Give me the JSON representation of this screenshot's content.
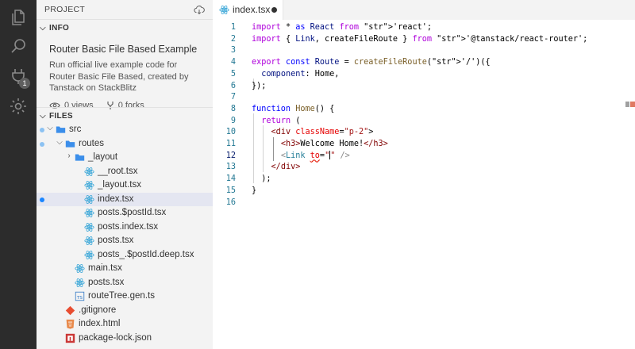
{
  "sidebar": {
    "header": "PROJECT",
    "info_section": {
      "title": "INFO",
      "project_title": "Router Basic File Based Example",
      "description": "Run official live example code for Router Basic File Based, created by Tanstack on StackBlitz",
      "views": "0 views",
      "forks": "0 forks"
    },
    "files_section": {
      "title": "FILES",
      "tree": [
        {
          "label": "src",
          "kind": "folder-open",
          "icon": "folder-icon"
        },
        {
          "label": "routes",
          "kind": "folder-open",
          "icon": "folder-icon"
        },
        {
          "label": "_layout",
          "kind": "folder-closed",
          "icon": "folder-icon"
        },
        {
          "label": "__root.tsx",
          "kind": "file",
          "icon": "react-file-icon"
        },
        {
          "label": "_layout.tsx",
          "kind": "file",
          "icon": "react-file-icon"
        },
        {
          "label": "index.tsx",
          "kind": "file",
          "icon": "react-file-icon"
        },
        {
          "label": "posts.$postId.tsx",
          "kind": "file",
          "icon": "react-file-icon"
        },
        {
          "label": "posts.index.tsx",
          "kind": "file",
          "icon": "react-file-icon"
        },
        {
          "label": "posts.tsx",
          "kind": "file",
          "icon": "react-file-icon"
        },
        {
          "label": "posts_.$postId.deep.tsx",
          "kind": "file",
          "icon": "react-file-icon"
        },
        {
          "label": "main.tsx",
          "kind": "file",
          "icon": "react-file-icon"
        },
        {
          "label": "posts.tsx",
          "kind": "file",
          "icon": "react-file-icon"
        },
        {
          "label": "routeTree.gen.ts",
          "kind": "file",
          "icon": "typescript-file-icon"
        },
        {
          "label": ".gitignore",
          "kind": "file",
          "icon": "git-file-icon"
        },
        {
          "label": "index.html",
          "kind": "file",
          "icon": "html-file-icon"
        },
        {
          "label": "package-lock.json",
          "kind": "file",
          "icon": "npm-file-icon"
        }
      ]
    }
  },
  "activity_bar": {
    "items": [
      "files-icon",
      "search-icon",
      "plug-icon",
      "gear-icon"
    ],
    "badge_count": "1"
  },
  "editor": {
    "tab_label": "index.tsx",
    "line_numbers": [
      "1",
      "2",
      "3",
      "4",
      "5",
      "6",
      "7",
      "8",
      "9",
      "10",
      "11",
      "12",
      "13",
      "14",
      "15",
      "16"
    ],
    "active_line": "12",
    "lines": [
      "import * as React from 'react';",
      "import { Link, createFileRoute } from '@tanstack/react-router';",
      "",
      "export const Route = createFileRoute('/')({",
      "  component: Home,",
      "});",
      "",
      "function Home() {",
      "  return (",
      "    <div className=\"p-2\">",
      "      <h3>Welcome Home!</h3>",
      "      <Link to=\"\" />",
      "    </div>",
      "  );",
      "}",
      ""
    ]
  },
  "colors": {
    "activity_bar": "#2c2c2c",
    "sidebar": "#f3f3f3",
    "selected_row": "#e4e6f1",
    "modified_dot": "#1a85ff",
    "react_icon": "#3ba7d8",
    "folder_icon": "#3b8eea"
  }
}
